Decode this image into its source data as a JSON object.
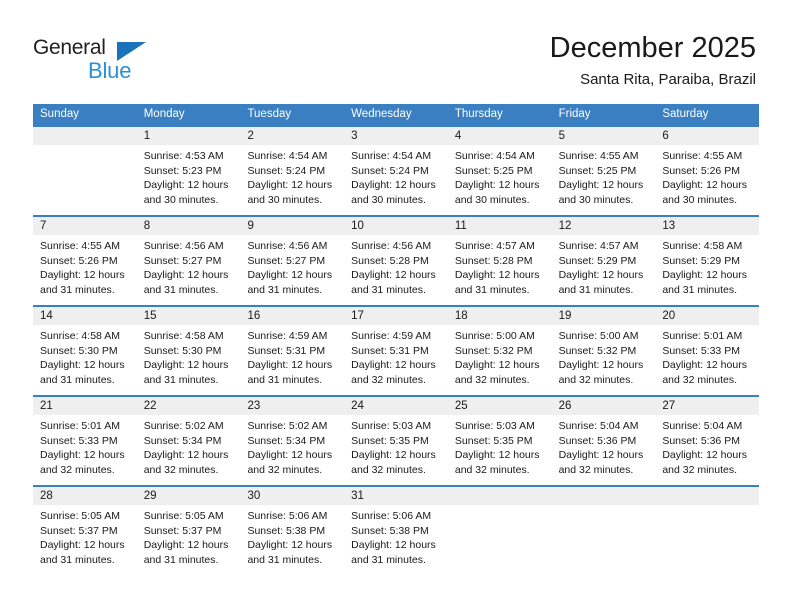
{
  "brand": {
    "name_part1": "General",
    "name_part2": "Blue",
    "triangle_icon": "triangle-icon",
    "color_dark": "#231f20",
    "color_blue": "#2b8fd6",
    "color_triangle": "#1a72ba"
  },
  "header": {
    "title": "December 2025",
    "subtitle": "Santa Rita, Paraiba, Brazil"
  },
  "theme": {
    "header_bg": "#3a7fc1",
    "header_text": "#ffffff",
    "number_band_bg": "#efefef",
    "cell_bg": "#ffffff",
    "text": "#1a1a1a"
  },
  "calendar": {
    "weekday_headers": [
      "Sunday",
      "Monday",
      "Tuesday",
      "Wednesday",
      "Thursday",
      "Friday",
      "Saturday"
    ],
    "weeks": [
      [
        {
          "day": "",
          "sunrise": "",
          "sunset": "",
          "daylight_line1": "",
          "daylight_line2": ""
        },
        {
          "day": "1",
          "sunrise": "Sunrise: 4:53 AM",
          "sunset": "Sunset: 5:23 PM",
          "daylight_line1": "Daylight: 12 hours",
          "daylight_line2": "and 30 minutes."
        },
        {
          "day": "2",
          "sunrise": "Sunrise: 4:54 AM",
          "sunset": "Sunset: 5:24 PM",
          "daylight_line1": "Daylight: 12 hours",
          "daylight_line2": "and 30 minutes."
        },
        {
          "day": "3",
          "sunrise": "Sunrise: 4:54 AM",
          "sunset": "Sunset: 5:24 PM",
          "daylight_line1": "Daylight: 12 hours",
          "daylight_line2": "and 30 minutes."
        },
        {
          "day": "4",
          "sunrise": "Sunrise: 4:54 AM",
          "sunset": "Sunset: 5:25 PM",
          "daylight_line1": "Daylight: 12 hours",
          "daylight_line2": "and 30 minutes."
        },
        {
          "day": "5",
          "sunrise": "Sunrise: 4:55 AM",
          "sunset": "Sunset: 5:25 PM",
          "daylight_line1": "Daylight: 12 hours",
          "daylight_line2": "and 30 minutes."
        },
        {
          "day": "6",
          "sunrise": "Sunrise: 4:55 AM",
          "sunset": "Sunset: 5:26 PM",
          "daylight_line1": "Daylight: 12 hours",
          "daylight_line2": "and 30 minutes."
        }
      ],
      [
        {
          "day": "7",
          "sunrise": "Sunrise: 4:55 AM",
          "sunset": "Sunset: 5:26 PM",
          "daylight_line1": "Daylight: 12 hours",
          "daylight_line2": "and 31 minutes."
        },
        {
          "day": "8",
          "sunrise": "Sunrise: 4:56 AM",
          "sunset": "Sunset: 5:27 PM",
          "daylight_line1": "Daylight: 12 hours",
          "daylight_line2": "and 31 minutes."
        },
        {
          "day": "9",
          "sunrise": "Sunrise: 4:56 AM",
          "sunset": "Sunset: 5:27 PM",
          "daylight_line1": "Daylight: 12 hours",
          "daylight_line2": "and 31 minutes."
        },
        {
          "day": "10",
          "sunrise": "Sunrise: 4:56 AM",
          "sunset": "Sunset: 5:28 PM",
          "daylight_line1": "Daylight: 12 hours",
          "daylight_line2": "and 31 minutes."
        },
        {
          "day": "11",
          "sunrise": "Sunrise: 4:57 AM",
          "sunset": "Sunset: 5:28 PM",
          "daylight_line1": "Daylight: 12 hours",
          "daylight_line2": "and 31 minutes."
        },
        {
          "day": "12",
          "sunrise": "Sunrise: 4:57 AM",
          "sunset": "Sunset: 5:29 PM",
          "daylight_line1": "Daylight: 12 hours",
          "daylight_line2": "and 31 minutes."
        },
        {
          "day": "13",
          "sunrise": "Sunrise: 4:58 AM",
          "sunset": "Sunset: 5:29 PM",
          "daylight_line1": "Daylight: 12 hours",
          "daylight_line2": "and 31 minutes."
        }
      ],
      [
        {
          "day": "14",
          "sunrise": "Sunrise: 4:58 AM",
          "sunset": "Sunset: 5:30 PM",
          "daylight_line1": "Daylight: 12 hours",
          "daylight_line2": "and 31 minutes."
        },
        {
          "day": "15",
          "sunrise": "Sunrise: 4:58 AM",
          "sunset": "Sunset: 5:30 PM",
          "daylight_line1": "Daylight: 12 hours",
          "daylight_line2": "and 31 minutes."
        },
        {
          "day": "16",
          "sunrise": "Sunrise: 4:59 AM",
          "sunset": "Sunset: 5:31 PM",
          "daylight_line1": "Daylight: 12 hours",
          "daylight_line2": "and 31 minutes."
        },
        {
          "day": "17",
          "sunrise": "Sunrise: 4:59 AM",
          "sunset": "Sunset: 5:31 PM",
          "daylight_line1": "Daylight: 12 hours",
          "daylight_line2": "and 32 minutes."
        },
        {
          "day": "18",
          "sunrise": "Sunrise: 5:00 AM",
          "sunset": "Sunset: 5:32 PM",
          "daylight_line1": "Daylight: 12 hours",
          "daylight_line2": "and 32 minutes."
        },
        {
          "day": "19",
          "sunrise": "Sunrise: 5:00 AM",
          "sunset": "Sunset: 5:32 PM",
          "daylight_line1": "Daylight: 12 hours",
          "daylight_line2": "and 32 minutes."
        },
        {
          "day": "20",
          "sunrise": "Sunrise: 5:01 AM",
          "sunset": "Sunset: 5:33 PM",
          "daylight_line1": "Daylight: 12 hours",
          "daylight_line2": "and 32 minutes."
        }
      ],
      [
        {
          "day": "21",
          "sunrise": "Sunrise: 5:01 AM",
          "sunset": "Sunset: 5:33 PM",
          "daylight_line1": "Daylight: 12 hours",
          "daylight_line2": "and 32 minutes."
        },
        {
          "day": "22",
          "sunrise": "Sunrise: 5:02 AM",
          "sunset": "Sunset: 5:34 PM",
          "daylight_line1": "Daylight: 12 hours",
          "daylight_line2": "and 32 minutes."
        },
        {
          "day": "23",
          "sunrise": "Sunrise: 5:02 AM",
          "sunset": "Sunset: 5:34 PM",
          "daylight_line1": "Daylight: 12 hours",
          "daylight_line2": "and 32 minutes."
        },
        {
          "day": "24",
          "sunrise": "Sunrise: 5:03 AM",
          "sunset": "Sunset: 5:35 PM",
          "daylight_line1": "Daylight: 12 hours",
          "daylight_line2": "and 32 minutes."
        },
        {
          "day": "25",
          "sunrise": "Sunrise: 5:03 AM",
          "sunset": "Sunset: 5:35 PM",
          "daylight_line1": "Daylight: 12 hours",
          "daylight_line2": "and 32 minutes."
        },
        {
          "day": "26",
          "sunrise": "Sunrise: 5:04 AM",
          "sunset": "Sunset: 5:36 PM",
          "daylight_line1": "Daylight: 12 hours",
          "daylight_line2": "and 32 minutes."
        },
        {
          "day": "27",
          "sunrise": "Sunrise: 5:04 AM",
          "sunset": "Sunset: 5:36 PM",
          "daylight_line1": "Daylight: 12 hours",
          "daylight_line2": "and 32 minutes."
        }
      ],
      [
        {
          "day": "28",
          "sunrise": "Sunrise: 5:05 AM",
          "sunset": "Sunset: 5:37 PM",
          "daylight_line1": "Daylight: 12 hours",
          "daylight_line2": "and 31 minutes."
        },
        {
          "day": "29",
          "sunrise": "Sunrise: 5:05 AM",
          "sunset": "Sunset: 5:37 PM",
          "daylight_line1": "Daylight: 12 hours",
          "daylight_line2": "and 31 minutes."
        },
        {
          "day": "30",
          "sunrise": "Sunrise: 5:06 AM",
          "sunset": "Sunset: 5:38 PM",
          "daylight_line1": "Daylight: 12 hours",
          "daylight_line2": "and 31 minutes."
        },
        {
          "day": "31",
          "sunrise": "Sunrise: 5:06 AM",
          "sunset": "Sunset: 5:38 PM",
          "daylight_line1": "Daylight: 12 hours",
          "daylight_line2": "and 31 minutes."
        },
        {
          "day": "",
          "sunrise": "",
          "sunset": "",
          "daylight_line1": "",
          "daylight_line2": ""
        },
        {
          "day": "",
          "sunrise": "",
          "sunset": "",
          "daylight_line1": "",
          "daylight_line2": ""
        },
        {
          "day": "",
          "sunrise": "",
          "sunset": "",
          "daylight_line1": "",
          "daylight_line2": ""
        }
      ]
    ]
  }
}
